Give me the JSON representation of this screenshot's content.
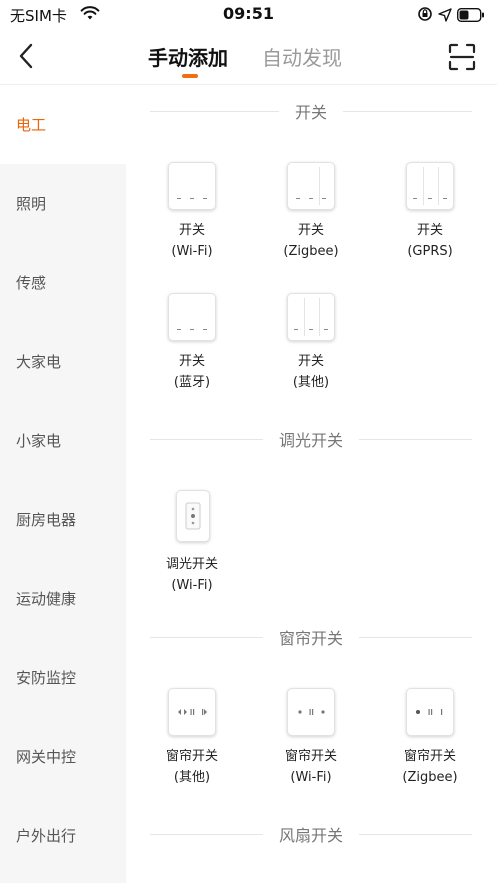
{
  "status": {
    "carrier": "无SIM卡",
    "time": "09:51"
  },
  "nav": {
    "tabs": [
      {
        "label": "手动添加",
        "active": true
      },
      {
        "label": "自动发现",
        "active": false
      }
    ],
    "accent_color": "#f0700f"
  },
  "sidebar": {
    "items": [
      {
        "label": "电工",
        "active": true
      },
      {
        "label": "照明",
        "active": false
      },
      {
        "label": "传感",
        "active": false
      },
      {
        "label": "大家电",
        "active": false
      },
      {
        "label": "小家电",
        "active": false
      },
      {
        "label": "厨房电器",
        "active": false
      },
      {
        "label": "运动健康",
        "active": false
      },
      {
        "label": "安防监控",
        "active": false
      },
      {
        "label": "网关中控",
        "active": false
      },
      {
        "label": "户外出行",
        "active": false
      }
    ]
  },
  "sections": [
    {
      "title": "开关",
      "devices": [
        {
          "name": "开关",
          "variant": "(Wi-Fi)",
          "icon": "switch-3gang-icon"
        },
        {
          "name": "开关",
          "variant": "(Zigbee)",
          "icon": "switch-3gang-icon"
        },
        {
          "name": "开关",
          "variant": "(GPRS)",
          "icon": "switch-3gang-icon"
        },
        {
          "name": "开关",
          "variant": "(蓝牙)",
          "icon": "switch-3gang-icon"
        },
        {
          "name": "开关",
          "variant": "(其他)",
          "icon": "switch-3gang-icon"
        }
      ]
    },
    {
      "title": "调光开关",
      "devices": [
        {
          "name": "调光开关",
          "variant": "(Wi-Fi)",
          "icon": "dimmer-switch-icon"
        }
      ]
    },
    {
      "title": "窗帘开关",
      "devices": [
        {
          "name": "窗帘开关",
          "variant": "(其他)",
          "icon": "curtain-switch-icon"
        },
        {
          "name": "窗帘开关",
          "variant": "(Wi-Fi)",
          "icon": "curtain-switch-icon"
        },
        {
          "name": "窗帘开关",
          "variant": "(Zigbee)",
          "icon": "curtain-switch-icon"
        }
      ]
    },
    {
      "title": "风扇开关",
      "devices": []
    }
  ]
}
